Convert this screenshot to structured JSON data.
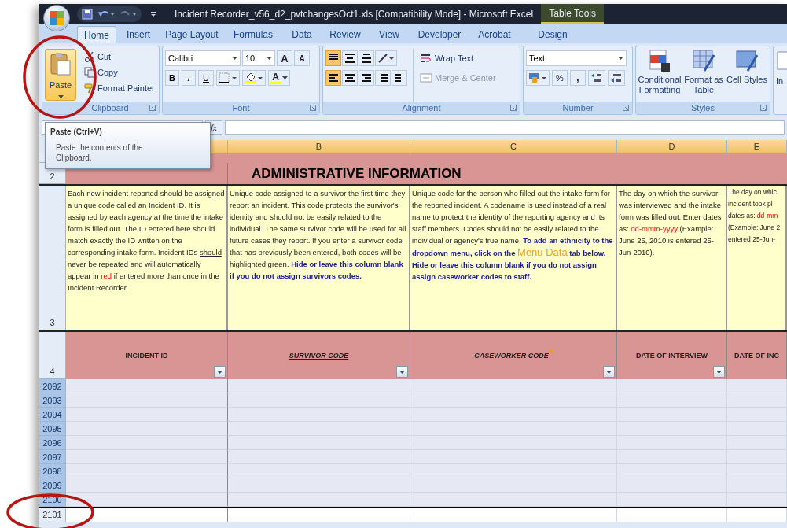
{
  "title_bar": {
    "title": "Incident Recorder_v56_d2_pvtchangesOct1.xls  [Compatibility Mode] - Microsoft Excel",
    "contextual_tab_group": "Table Tools"
  },
  "tabs": [
    {
      "label": "Home",
      "selected": true
    },
    {
      "label": "Insert",
      "selected": false
    },
    {
      "label": "Page Layout",
      "selected": false
    },
    {
      "label": "Formulas",
      "selected": false
    },
    {
      "label": "Data",
      "selected": false
    },
    {
      "label": "Review",
      "selected": false
    },
    {
      "label": "View",
      "selected": false
    },
    {
      "label": "Developer",
      "selected": false
    },
    {
      "label": "Acrobat",
      "selected": false
    },
    {
      "label": "Design",
      "selected": false
    }
  ],
  "ribbon": {
    "clipboard": {
      "paste": "Paste",
      "cut": "Cut",
      "copy": "Copy",
      "format_painter": "Format Painter",
      "label": "Clipboard"
    },
    "font": {
      "font_name": "Calibri",
      "font_size": "10",
      "grow": "A",
      "shrink": "A",
      "bold": "B",
      "italic": "I",
      "underline": "U",
      "font_color": "A",
      "label": "Font"
    },
    "alignment": {
      "wrap_text": "Wrap Text",
      "merge": "Merge & Center",
      "label": "Alignment"
    },
    "number": {
      "format": "Text",
      "percent": "%",
      "comma": ",",
      "label": "Number"
    },
    "styles": {
      "conditional": "Conditional Formatting",
      "format_table": "Format as Table",
      "cell_styles": "Cell Styles",
      "label": "Styles"
    },
    "cut_off_button": "In"
  },
  "tooltip": {
    "title": "Paste (Ctrl+V)",
    "body": "Paste the contents of the Clipboard."
  },
  "formula_bar": {
    "fx": "fx"
  },
  "column_headers": [
    "B",
    "C",
    "D",
    "E"
  ],
  "row_numbers": {
    "row_2": "2",
    "row_3": "3",
    "row_4": "4"
  },
  "banner": "ADMINISTRATIVE INFORMATION",
  "descriptions": [
    {
      "segments": [
        {
          "kind": "text",
          "text": "Each new incident reported should be assigned a unique code called an "
        },
        {
          "kind": "underline",
          "text": "Incident ID"
        },
        {
          "kind": "text",
          "text": ". It is assigned by each agency at the time the intake form is filled out. The ID entered here should match exactly the ID written on the corresponding intake form. Incident IDs "
        },
        {
          "kind": "underline",
          "text": "should never be repeated"
        },
        {
          "kind": "text",
          "text": " and will automatically appear in "
        },
        {
          "kind": "red",
          "text": "red"
        },
        {
          "kind": "text",
          "text": " if entered more than once in the Incident Recorder."
        }
      ]
    },
    {
      "segments": [
        {
          "kind": "text",
          "text": "Unique code assigned to a survivor the first time they report an incident.  This code protects the survivor's identity and should not be easily related to the individual. The same survivor code will be used for all future cases they report.  If you enter a survivor code that has previously been entered, both codes will be highlighted green.  "
        },
        {
          "kind": "note",
          "text": "Hide or leave this column blank if you do not assign survivors codes."
        }
      ]
    },
    {
      "segments": [
        {
          "kind": "text",
          "text": "Unique code for the person who filled out the intake form for the reported incident. A codename is used instead of a real name to protect the identity of the reporting agency and its staff members.  Codes should not be easily related to the individual or agency's true name.  "
        },
        {
          "kind": "note",
          "text": "To add an ethnicity to the dropdown menu, click on the "
        },
        {
          "kind": "highlight",
          "text": "Menu Data"
        },
        {
          "kind": "note",
          "text": " tab below. Hide or leave this column blank if you do not assign assign caseworker codes to staff."
        }
      ]
    },
    {
      "segments": [
        {
          "kind": "text",
          "text": "The day on which the survivor was interviewed and the intake form was filled out. Enter dates as: "
        },
        {
          "kind": "red",
          "text": "dd-mmm-yyyy"
        },
        {
          "kind": "text",
          "text": " (Example: June 25, 2010 is entered 25-Jun-2010)."
        }
      ]
    },
    {
      "segments": [
        {
          "kind": "text",
          "text": "The day on whic\nincident took pl\ndates as: "
        },
        {
          "kind": "red",
          "text": "dd-mm"
        },
        {
          "kind": "text",
          "text": "\n(Example: June 2\nentered 25-Jun-"
        }
      ]
    }
  ],
  "field_headers": [
    {
      "label": "INCIDENT ID",
      "filter": true,
      "comment": false
    },
    {
      "label": "SURVIVOR CODE",
      "filter": true,
      "comment": false
    },
    {
      "label": "CASEWORKER CODE",
      "filter": true,
      "comment": true
    },
    {
      "label": "DATE OF INTERVIEW",
      "filter": true,
      "comment": false
    },
    {
      "label": "DATE OF INC",
      "filter": false,
      "comment": false
    }
  ],
  "rows": [
    {
      "number": "2092",
      "selected": true
    },
    {
      "number": "2093",
      "selected": true
    },
    {
      "number": "2094",
      "selected": true
    },
    {
      "number": "2095",
      "selected": true
    },
    {
      "number": "2096",
      "selected": true
    },
    {
      "number": "2097",
      "selected": true
    },
    {
      "number": "2098",
      "selected": true
    },
    {
      "number": "2099",
      "selected": true
    },
    {
      "number": "2100",
      "selected": true
    },
    {
      "number": "2101",
      "selected": false
    }
  ]
}
